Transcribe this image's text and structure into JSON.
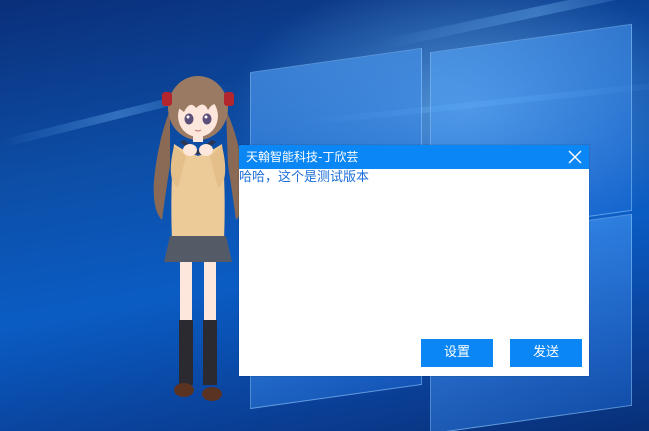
{
  "dialog": {
    "title": "天翰智能科技-丁欣芸",
    "message": "哈哈，这个是测试版本",
    "settings_label": "设置",
    "send_label": "发送"
  },
  "colors": {
    "accent": "#0a86f5",
    "message_text": "#1a6ed8",
    "desktop_blue": "#0a5cc4"
  },
  "icons": {
    "close": "close-icon"
  }
}
